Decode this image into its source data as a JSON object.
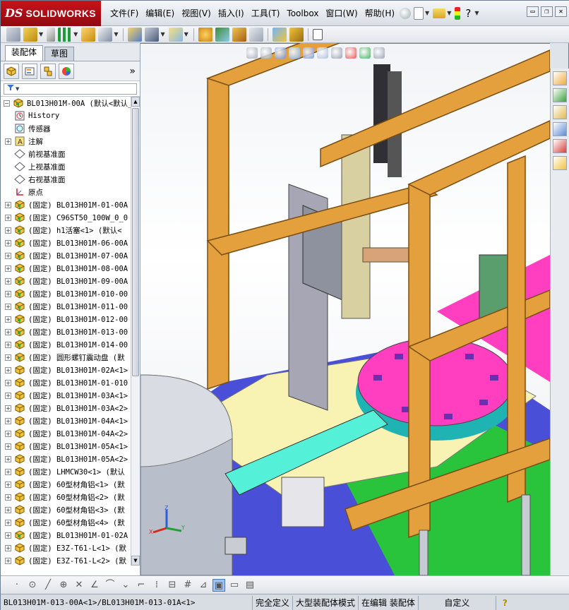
{
  "app": {
    "brand_prefix": "DS",
    "brand_name": "SOLIDWORKS"
  },
  "menu": [
    "文件(F)",
    "编辑(E)",
    "视图(V)",
    "插入(I)",
    "工具(T)",
    "Toolbox",
    "窗口(W)",
    "帮助(H)"
  ],
  "title_icons": [
    "pin-icon",
    "new-document-icon",
    "open-icon",
    "traffic-light-icon",
    "help-icon"
  ],
  "window_controls": {
    "minimize": "▭",
    "restore": "❐",
    "close": "✕"
  },
  "toolbar": {
    "icons": [
      "edit-component-icon",
      "insert-components-icon",
      "mate-icon",
      "linear-pattern-icon",
      "smart-fasteners-icon",
      "move-component-icon",
      "show-hidden-icon",
      "assembly-features-icon",
      "reference-geometry-icon",
      "new-motion-study-icon",
      "bill-of-materials-icon",
      "exploded-view-icon",
      "explode-line-sketch-icon",
      "interference-detection-icon",
      "clearance-verification-icon",
      "hole-alignment-icon"
    ]
  },
  "left_panel": {
    "tabs": [
      "装配体",
      "草图"
    ],
    "active_tab": 0,
    "manager_icons": [
      "feature-manager-icon",
      "property-manager-icon",
      "configuration-manager-icon",
      "display-manager-icon"
    ],
    "more_label": "»",
    "filter_icon": "filter-icon"
  },
  "tree": [
    {
      "label": "BL013H01M-00A  (默认<默认_",
      "icon": "assembly-icon",
      "expand": "−",
      "indent": 0
    },
    {
      "label": "History",
      "icon": "history-icon",
      "expand": "",
      "indent": 1
    },
    {
      "label": "传感器",
      "icon": "sensor-icon",
      "expand": "",
      "indent": 1
    },
    {
      "label": "注解",
      "icon": "annotation-icon",
      "expand": "+",
      "indent": 1
    },
    {
      "label": "前视基准面",
      "icon": "plane-icon",
      "expand": "",
      "indent": 1
    },
    {
      "label": "上视基准面",
      "icon": "plane-icon",
      "expand": "",
      "indent": 1
    },
    {
      "label": "右视基准面",
      "icon": "plane-icon",
      "expand": "",
      "indent": 1
    },
    {
      "label": "原点",
      "icon": "origin-icon",
      "expand": "",
      "indent": 1
    },
    {
      "label": "(固定) BL013H01M-01-00A",
      "icon": "assembly-icon",
      "expand": "+",
      "indent": 1
    },
    {
      "label": "(固定) C96ST50_100W_0_0",
      "icon": "assembly-icon",
      "expand": "+",
      "indent": 1
    },
    {
      "label": "(固定) h1活塞<1> (默认<",
      "icon": "assembly-icon",
      "expand": "+",
      "indent": 1
    },
    {
      "label": "(固定) BL013H01M-06-00A",
      "icon": "assembly-icon",
      "expand": "+",
      "indent": 1
    },
    {
      "label": "(固定) BL013H01M-07-00A",
      "icon": "assembly-icon",
      "expand": "+",
      "indent": 1
    },
    {
      "label": "(固定) BL013H01M-08-00A",
      "icon": "assembly-icon",
      "expand": "+",
      "indent": 1
    },
    {
      "label": "(固定) BL013H01M-09-00A",
      "icon": "assembly-icon",
      "expand": "+",
      "indent": 1
    },
    {
      "label": "(固定) BL013H01M-010-00",
      "icon": "assembly-icon",
      "expand": "+",
      "indent": 1
    },
    {
      "label": "(固定) BL013H01M-011-00",
      "icon": "assembly-icon",
      "expand": "+",
      "indent": 1
    },
    {
      "label": "(固定) BL013H01M-012-00",
      "icon": "assembly-icon",
      "expand": "+",
      "indent": 1
    },
    {
      "label": "(固定) BL013H01M-013-00",
      "icon": "assembly-icon",
      "expand": "+",
      "indent": 1
    },
    {
      "label": "(固定) BL013H01M-014-00",
      "icon": "assembly-icon",
      "expand": "+",
      "indent": 1
    },
    {
      "label": "(固定) 圆形螺钉震动盘 (默",
      "icon": "assembly-icon",
      "expand": "+",
      "indent": 1
    },
    {
      "label": "(固定) BL013H01M-02A<1>",
      "icon": "part-icon",
      "expand": "+",
      "indent": 1
    },
    {
      "label": "(固定) BL013H01M-01-010",
      "icon": "part-icon",
      "expand": "+",
      "indent": 1
    },
    {
      "label": "(固定) BL013H01M-03A<1>",
      "icon": "part-icon",
      "expand": "+",
      "indent": 1
    },
    {
      "label": "(固定) BL013H01M-03A<2>",
      "icon": "part-icon",
      "expand": "+",
      "indent": 1
    },
    {
      "label": "(固定) BL013H01M-04A<1>",
      "icon": "part-icon",
      "expand": "+",
      "indent": 1
    },
    {
      "label": "(固定) BL013H01M-04A<2>",
      "icon": "part-icon",
      "expand": "+",
      "indent": 1
    },
    {
      "label": "(固定) BL013H01M-05A<1>",
      "icon": "part-icon",
      "expand": "+",
      "indent": 1
    },
    {
      "label": "(固定) BL013H01M-05A<2>",
      "icon": "part-icon",
      "expand": "+",
      "indent": 1
    },
    {
      "label": "(固定) LHMCW30<1> (默认",
      "icon": "part-icon",
      "expand": "+",
      "indent": 1
    },
    {
      "label": "(固定) 60型材角铝<1> (默",
      "icon": "part-icon",
      "expand": "+",
      "indent": 1
    },
    {
      "label": "(固定) 60型材角铝<2> (默",
      "icon": "part-icon",
      "expand": "+",
      "indent": 1
    },
    {
      "label": "(固定) 60型材角铝<3> (默",
      "icon": "part-icon",
      "expand": "+",
      "indent": 1
    },
    {
      "label": "(固定) 60型材角铝<4> (默",
      "icon": "part-icon",
      "expand": "+",
      "indent": 1
    },
    {
      "label": "(固定) BL013H01M-01-02A",
      "icon": "assembly-icon",
      "expand": "+",
      "indent": 1
    },
    {
      "label": "(固定) E3Z-T61-L<1> (默",
      "icon": "part-icon",
      "expand": "+",
      "indent": 1
    },
    {
      "label": "(固定) E3Z-T61-L<2> (默",
      "icon": "part-icon",
      "expand": "+",
      "indent": 1
    }
  ],
  "viewport": {
    "heads_up_icons": [
      "zoom-to-fit-icon",
      "zoom-area-icon",
      "previous-view-icon",
      "section-view-icon",
      "view-orientation-icon",
      "display-style-icon",
      "hide-show-icon",
      "edit-appearance-icon",
      "apply-scene-icon",
      "view-settings-icon"
    ],
    "triad_axes": [
      "X",
      "Y",
      "Z"
    ]
  },
  "task_pane_icons": [
    "solidworks-resources-icon",
    "design-library-icon",
    "file-explorer-icon",
    "view-palette-icon",
    "appearances-icon",
    "custom-properties-icon"
  ],
  "bottom_toolbar": [
    "·",
    "⊙",
    "╱",
    "⊕",
    "✕",
    "∠",
    "⌒",
    "⌄",
    "⌐",
    "⁞",
    "⊟",
    "#",
    "⊿",
    "▣",
    "▭",
    "▤"
  ],
  "status": {
    "path": "BL013H01M-013-00A<1>/BL013H01M-013-01A<1>",
    "definition": "完全定义",
    "mode": "大型装配体模式",
    "editing": "在编辑 装配体",
    "custom": "自定义",
    "help_icon": "?"
  },
  "colors": {
    "frame": "#e3a03c",
    "magenta": "#ff3fbf",
    "floor_green": "#29c43c",
    "floor_blue": "#4a4fd8",
    "cream": "#f8f2b3",
    "gray": "#a6a6b4"
  }
}
